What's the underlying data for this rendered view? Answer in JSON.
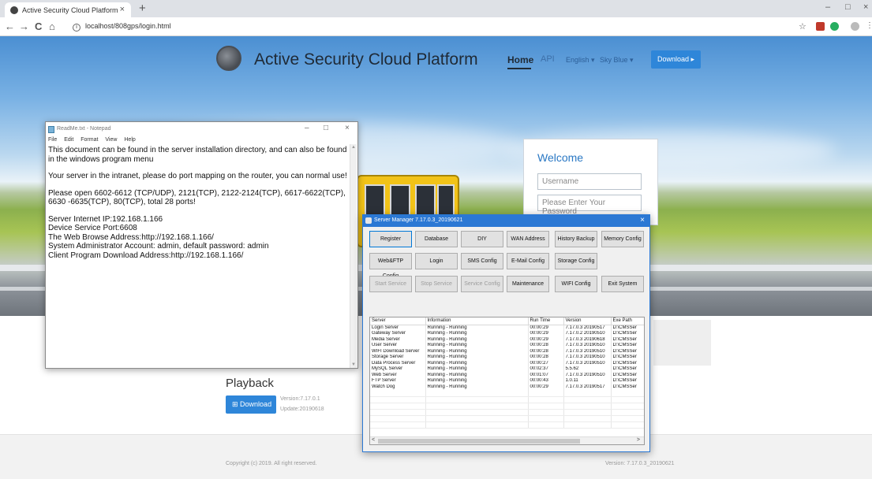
{
  "browser": {
    "tab_title": "Active Security Cloud Platform",
    "tab_close": "×",
    "new_tab": "+",
    "url": "localhost/808gps/login.html",
    "back": "←",
    "forward": "→",
    "reload": "C",
    "home": "⌂",
    "star": "☆",
    "window_min": "–",
    "window_max": "□",
    "window_close": "×"
  },
  "site": {
    "title": "Active Security Cloud Platform",
    "nav": {
      "home": "Home",
      "api": "API",
      "language": "English ▾",
      "theme": "Sky Blue ▾",
      "download": "Download ▸"
    },
    "login": {
      "welcome": "Welcome",
      "username_placeholder": "Username",
      "password_placeholder": "Please Enter Your Password"
    },
    "playback": {
      "title": "Playback",
      "download": "Download",
      "version": "Version:7.17.0.1",
      "update": "Update:20190618"
    },
    "footer": {
      "copyright": "Copyright (c) 2019. All right reserved.",
      "version": "Version: 7.17.0.3_20190621"
    }
  },
  "notepad": {
    "title": "ReadMe.txt - Notepad",
    "controls": {
      "min": "–",
      "max": "□",
      "close": "×"
    },
    "menu": [
      "File",
      "Edit",
      "Format",
      "View",
      "Help"
    ],
    "paragraphs": [
      "This document can be found in the server installation directory, and can also be found in the windows program menu",
      "Your server in the intranet, please do port mapping on the router, you can normal use!",
      "Please open 6602-6612 (TCP/UDP), 2121(TCP), 2122-2124(TCP), 6617-6622(TCP), 6630 -6635(TCP), 80(TCP), total 28 ports!"
    ],
    "info_lines": [
      "Server Internet IP:192.168.1.166",
      "Device Service Port:6608",
      "The Web Browse Address:http://192.168.1.166/",
      "System Administrator Account: admin, default password: admin",
      "Client Program Download Address:http://192.168.1.166/"
    ]
  },
  "server_manager": {
    "title": "Server Manager 7.17.0.3_20190621",
    "close": "×",
    "buttons_row1": [
      "Register",
      "Database",
      "DIY",
      "WAN Address",
      "History Backup",
      "Memory Config"
    ],
    "buttons_row2": [
      "Web&FTP Config",
      "Login",
      "SMS Config",
      "E-Mail Config",
      "Storage Config"
    ],
    "buttons_row3": [
      "Start Service",
      "Stop Service",
      "Service Config",
      "Maintenance",
      "WIFI Config",
      "Exit System"
    ],
    "columns": [
      "Server",
      "Information",
      "Run Time",
      "Version",
      "Exe Path"
    ],
    "rows": [
      [
        "Login Server",
        "Running - Running",
        "00:00:29",
        "7.17.0.3 20190517",
        "D:\\CMSSer"
      ],
      [
        "Gateway Server",
        "Running - Running",
        "00:00:29",
        "7.17.0.2 20190510",
        "D:\\CMSSer"
      ],
      [
        "Media Server",
        "Running - Running",
        "00:00:29",
        "7.17.0.3 20190618",
        "D:\\CMSSer"
      ],
      [
        "User Server",
        "Running - Running",
        "00:00:28",
        "7.17.0.3 20190510",
        "D:\\CMSSer"
      ],
      [
        "WIFI Download Server",
        "Running - Running",
        "00:00:28",
        "7.17.0.3 20190510",
        "D:\\CMSSer"
      ],
      [
        "Storage Server",
        "Running - Running",
        "00:00:28",
        "7.17.0.3 20190510",
        "D:\\CMSSer"
      ],
      [
        "Data Process Server",
        "Running - Running",
        "00:00:27",
        "7.17.0.3 20190510",
        "D:\\CMSSer"
      ],
      [
        "MySQL Server",
        "Running - Running",
        "00:02:37",
        "5.5.62",
        "D:\\CMSSer"
      ],
      [
        "Web Server",
        "Running - Running",
        "00:01:07",
        "7.17.0.3 20190510",
        "D:\\CMSSer"
      ],
      [
        "FTP Server",
        "Running - Running",
        "00:00:43",
        "1.0.11",
        "D:\\CMSSer"
      ],
      [
        "Watch Dog",
        "Running - Running",
        "00:00:29",
        "7.17.0.3 20190517",
        "D:\\CMSSer"
      ]
    ],
    "scroll_left": "<",
    "scroll_right": ">"
  }
}
